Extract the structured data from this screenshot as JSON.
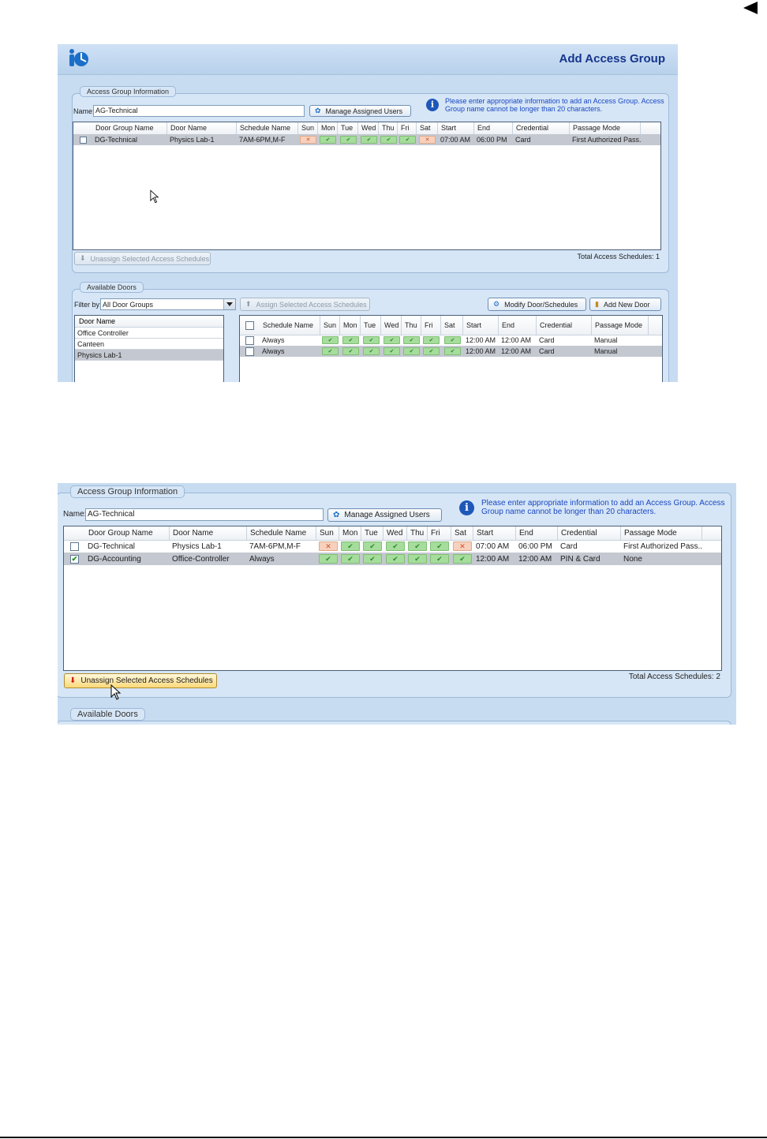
{
  "screen1": {
    "title": "Add Access Group",
    "info_group": {
      "legend": "Access Group Information",
      "name_label": "Name:",
      "name_value": "AG-Technical",
      "manage_users_button": "Manage Assigned Users",
      "info_text_1": "Please enter appropriate information to add an Access Group. Access",
      "info_text_2": "Group name cannot be longer than 20 characters.",
      "columns": [
        "Door Group Name",
        "Door Name",
        "Schedule Name",
        "Sun",
        "Mon",
        "Tue",
        "Wed",
        "Thu",
        "Fri",
        "Sat",
        "Start",
        "End",
        "Credential",
        "Passage Mode"
      ],
      "rows": [
        {
          "checked": false,
          "selected": true,
          "door_group": "DG-Technical",
          "door": "Physics Lab-1",
          "schedule": "7AM-6PM,M-F",
          "days": [
            false,
            true,
            true,
            true,
            true,
            true,
            false
          ],
          "start": "07:00 AM",
          "end": "06:00 PM",
          "credential": "Card",
          "passage_mode": "First Authorized Pass..."
        }
      ],
      "unassign_button": "Unassign Selected Access Schedules",
      "total": "Total Access Schedules: 1"
    },
    "doors_group": {
      "legend": "Available Doors",
      "filter_label": "Filter by:",
      "filter_value": "All Door Groups",
      "assign_button": "Assign Selected Access Schedules",
      "modify_button": "Modify Door/Schedules",
      "add_door_button": "Add New Door",
      "door_list_header": "Door Name",
      "doors": [
        {
          "name": "Office Controller",
          "selected": false
        },
        {
          "name": "Canteen",
          "selected": false
        },
        {
          "name": "Physics Lab-1",
          "selected": true
        }
      ],
      "columns": [
        "Schedule Name",
        "Sun",
        "Mon",
        "Tue",
        "Wed",
        "Thu",
        "Fri",
        "Sat",
        "Start",
        "End",
        "Credential",
        "Passage Mode"
      ],
      "rows": [
        {
          "checked": false,
          "selected": false,
          "schedule": "Always",
          "days": [
            true,
            true,
            true,
            true,
            true,
            true,
            true
          ],
          "start": "12:00 AM",
          "end": "12:00 AM",
          "credential": "Card",
          "passage_mode": "Manual"
        },
        {
          "checked": false,
          "selected": true,
          "schedule": "Always",
          "days": [
            true,
            true,
            true,
            true,
            true,
            true,
            true
          ],
          "start": "12:00 AM",
          "end": "12:00 AM",
          "credential": "Card",
          "passage_mode": "Manual"
        }
      ]
    }
  },
  "screen2": {
    "info_group": {
      "legend": "Access Group Information",
      "name_label": "Name:",
      "name_value": "AG-Technical",
      "manage_users_button": "Manage Assigned Users",
      "info_text_1": "Please enter appropriate information to add an Access Group. Access",
      "info_text_2": "Group name cannot be longer than 20 characters.",
      "columns": [
        "Door Group Name",
        "Door Name",
        "Schedule Name",
        "Sun",
        "Mon",
        "Tue",
        "Wed",
        "Thu",
        "Fri",
        "Sat",
        "Start",
        "End",
        "Credential",
        "Passage Mode"
      ],
      "rows": [
        {
          "checked": false,
          "selected": false,
          "door_group": "DG-Technical",
          "door": "Physics Lab-1",
          "schedule": "7AM-6PM,M-F",
          "days": [
            false,
            true,
            true,
            true,
            true,
            true,
            false
          ],
          "start": "07:00 AM",
          "end": "06:00 PM",
          "credential": "Card",
          "passage_mode": "First Authorized Pass..."
        },
        {
          "checked": true,
          "selected": true,
          "door_group": "DG-Accounting",
          "door": "Office-Controller",
          "schedule": "Always",
          "days": [
            true,
            true,
            true,
            true,
            true,
            true,
            true
          ],
          "start": "12:00 AM",
          "end": "12:00 AM",
          "credential": "PIN & Card",
          "passage_mode": "None"
        }
      ],
      "unassign_button": "Unassign Selected Access Schedules",
      "total": "Total Access Schedules: 2"
    },
    "doors_legend": "Available Doors"
  },
  "icons": {
    "on_mark": "✔",
    "off_mark": "✕",
    "check_mark": "✔"
  },
  "colors": {
    "title": "#16368c",
    "info_text": "#1a47c2",
    "day_on": "#a6dc9c",
    "day_off": "#f7d1bd",
    "row_selected": "#c4c8d0"
  }
}
